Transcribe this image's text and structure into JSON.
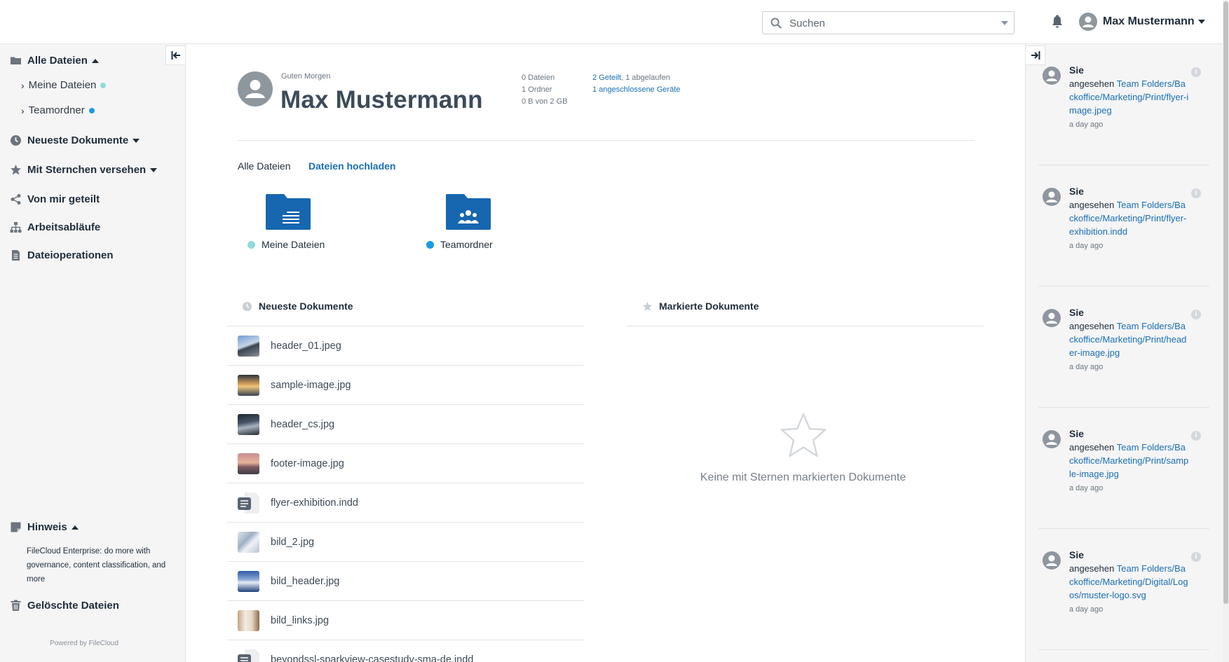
{
  "header": {
    "search_placeholder": "Suchen",
    "user_name": "Max Mustermann"
  },
  "sidebar": {
    "all_files": "Alle Dateien",
    "my_files": "Meine Dateien",
    "team_folders": "Teamordner",
    "recent_docs": "Neueste Dokumente",
    "starred": "Mit Sternchen versehen",
    "shared_by_me": "Von mir geteilt",
    "workflows": "Arbeitsabläufe",
    "file_operations": "Dateioperationen",
    "hint_title": "Hinweis",
    "hint_text": "FileCloud Enterprise: do more with governance, content classification, and more",
    "deleted_files": "Gelöschte Dateien",
    "powered_by": "Powered by FileCloud",
    "my_files_dot_color": "#8fdbd7",
    "team_dot_color": "#1a9be6"
  },
  "profile": {
    "greeting": "Guten Morgen",
    "name": "Max Mustermann",
    "files_count": "0 Dateien",
    "folders_count": "1 Ordner",
    "storage": "0 B von 2 GB",
    "shared_link": "2 Geteilt",
    "expired": ", 1 abgelaufen",
    "devices_link": "1 angeschlossene Geräte"
  },
  "tabs": {
    "all_files": "Alle Dateien",
    "upload": "Dateien hochladen"
  },
  "folders": [
    {
      "label": "Meine Dateien",
      "icon": "folder-document-icon",
      "dot_color": "#8fdbd7"
    },
    {
      "label": "Teamordner",
      "icon": "folder-team-icon",
      "dot_color": "#1a9be6"
    }
  ],
  "recent": {
    "title": "Neueste Dokumente",
    "files": [
      {
        "name": "header_01.jpeg",
        "thumb": "image"
      },
      {
        "name": "sample-image.jpg",
        "thumb": "image"
      },
      {
        "name": "header_cs.jpg",
        "thumb": "image"
      },
      {
        "name": "footer-image.jpg",
        "thumb": "image"
      },
      {
        "name": "flyer-exhibition.indd",
        "thumb": "document"
      },
      {
        "name": "bild_2.jpg",
        "thumb": "image"
      },
      {
        "name": "bild_header.jpg",
        "thumb": "image"
      },
      {
        "name": "bild_links.jpg",
        "thumb": "image"
      },
      {
        "name": "beyondssl-sparkview-casestudy-sma-de.indd",
        "thumb": "document"
      }
    ]
  },
  "starred": {
    "title": "Markierte Dokumente",
    "empty_text": "Keine mit Sternen markierten Dokumente"
  },
  "activity": [
    {
      "user": "Sie",
      "action": "angesehen",
      "path": "Team Folders/Backoffice/Marketing/Print/flyer-image.jpeg",
      "time": "a day ago"
    },
    {
      "user": "Sie",
      "action": "angesehen",
      "path": "Team Folders/Backoffice/Marketing/Print/flyer-exhibition.indd",
      "time": "a day ago"
    },
    {
      "user": "Sie",
      "action": "angesehen",
      "path": "Team Folders/Backoffice/Marketing/Print/header-image.jpg",
      "time": "a day ago"
    },
    {
      "user": "Sie",
      "action": "angesehen",
      "path": "Team Folders/Backoffice/Marketing/Print/sample-image.jpg",
      "time": "a day ago"
    },
    {
      "user": "Sie",
      "action": "angesehen",
      "path": "Team Folders/Backoffice/Marketing/Digital/Logos/muster-logo.svg",
      "time": "a day ago"
    }
  ],
  "colors": {
    "accent": "#1a6fb5",
    "folder_blue": "#1766b0",
    "sidebar_bg": "#f5f5f6"
  }
}
